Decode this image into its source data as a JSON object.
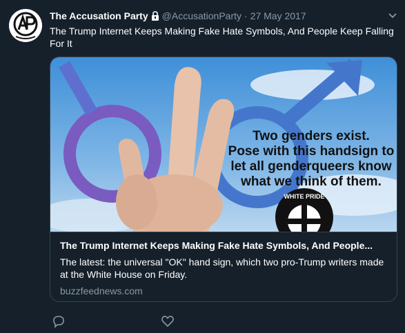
{
  "tweet": {
    "name": "The Accusation Party",
    "handle": "@AccusationParty",
    "separator": "·",
    "date": "27 May 2017",
    "text": "The Trump Internet Keeps Making Fake Hate Symbols, And People Keep Falling For It"
  },
  "card": {
    "image_text_lines": [
      "Two genders exist.",
      "Pose with this handsign to",
      "let all genderqueers know",
      "what we think of them."
    ],
    "badge_text": "WHITE PRIDE",
    "title": "The Trump Internet Keeps Making Fake Hate Symbols, And People...",
    "description": "The latest: the universal \"OK\" hand sign, which two pro-Trump writers made at the White House on Friday.",
    "domain": "buzzfeednews.com"
  },
  "icons": {
    "lock": "lock-icon",
    "chevron": "chevron-down-icon",
    "reply": "reply-icon",
    "like": "heart-icon"
  },
  "colors": {
    "background": "#15202b",
    "secondary_text": "#8899a6",
    "border": "#38444d"
  }
}
